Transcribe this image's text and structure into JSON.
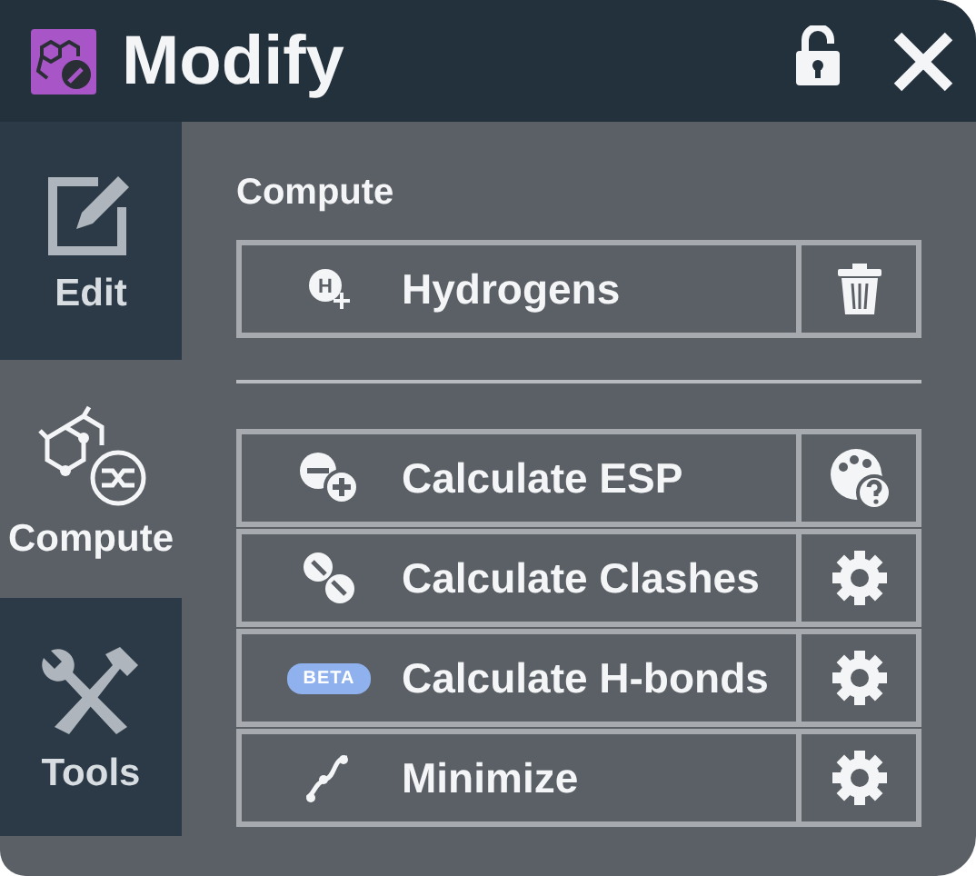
{
  "window": {
    "title": "Modify",
    "locked": false
  },
  "tabs": [
    {
      "label": "Edit",
      "kind": "edit",
      "selected": false
    },
    {
      "label": "Compute",
      "kind": "compute",
      "selected": true
    },
    {
      "label": "Tools",
      "kind": "tools",
      "selected": false
    }
  ],
  "section_title": "Compute",
  "applied": [
    {
      "label": "Hydrogens",
      "kind": "hydrogen",
      "icon_text": "H",
      "option": {
        "kind": "trash"
      }
    }
  ],
  "actions": [
    {
      "label": "Calculate ESP",
      "kind": "esp",
      "option": {
        "kind": "palette"
      }
    },
    {
      "label": "Calculate Clashes",
      "kind": "clashes",
      "option": {
        "kind": "settings"
      }
    },
    {
      "label": "Calculate H-bonds",
      "kind": "beta",
      "badge": "BETA",
      "option": {
        "kind": "settings"
      }
    },
    {
      "label": "Minimize",
      "kind": "minimize",
      "option": {
        "kind": "settings"
      }
    }
  ]
}
